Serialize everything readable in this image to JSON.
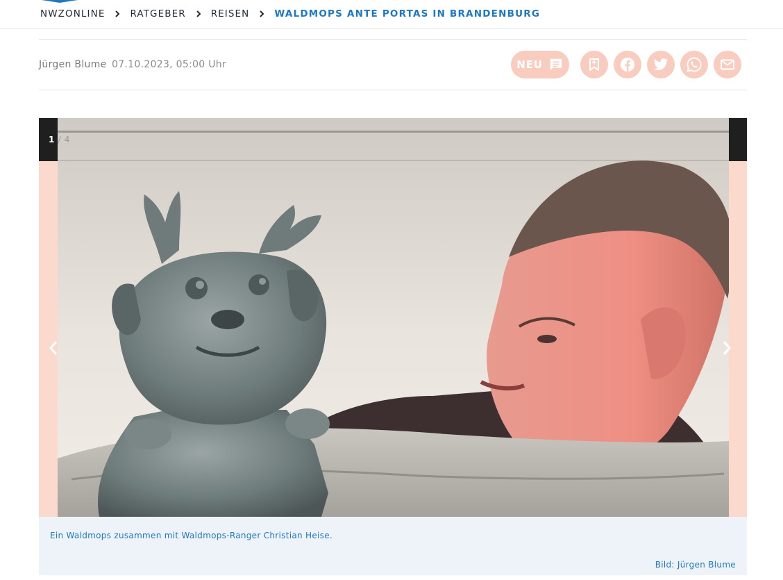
{
  "breadcrumb": {
    "items": [
      "NWZONLINE",
      "RATGEBER",
      "REISEN"
    ],
    "current": "WALDMOPS ANTE PORTAS IN BRANDENBURG"
  },
  "article_meta": {
    "author": "Jürgen Blume",
    "date": "07.10.2023, 05:00 Uhr"
  },
  "actions": {
    "neu_label": "NEU",
    "icons": [
      "comment-icon",
      "bookmark-icon",
      "facebook-icon",
      "twitter-icon",
      "whatsapp-icon",
      "mail-icon"
    ]
  },
  "gallery": {
    "current": "1",
    "separator": "/",
    "total": "4",
    "caption": "Ein Waldmops zusammen mit Waldmops-Ranger Christian Heise.",
    "credit": "Bild: Jürgen Blume"
  },
  "colors": {
    "accent": "#1e78c2",
    "button_bg": "#f8cdbf",
    "caption_bg": "#eef3f9"
  }
}
